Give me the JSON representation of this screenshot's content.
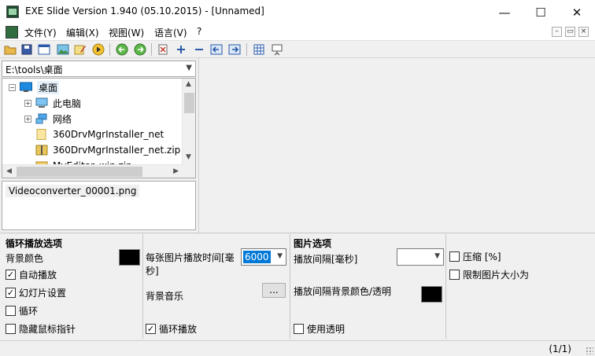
{
  "window": {
    "title": "EXE Slide Version 1.940 (05.10.2015) - [Unnamed]",
    "minimize": "—",
    "maximize": "☐",
    "close": "✕"
  },
  "menu": {
    "items": [
      "文件(Y)",
      "编辑(X)",
      "视图(W)",
      "语言(V)",
      "?"
    ],
    "mdi": [
      "–",
      "▭",
      "×"
    ]
  },
  "toolbar": {
    "icons": [
      "open-folder-icon",
      "save-icon",
      "window-icon",
      "image-icon",
      "edit-image-icon",
      "play-icon",
      "refresh-left-icon",
      "refresh-right-icon",
      "new-file-icon",
      "add-icon",
      "remove-icon",
      "move-left-icon",
      "move-right-icon",
      "grid-icon",
      "presentation-icon"
    ]
  },
  "explorer": {
    "path": "E:\\tools\\桌面",
    "tree": [
      {
        "label": "桌面",
        "expander": "−",
        "icon": "desktop-icon",
        "selected": true
      },
      {
        "label": "此电脑",
        "expander": "+",
        "icon": "computer-icon"
      },
      {
        "label": "网络",
        "expander": "+",
        "icon": "network-icon"
      },
      {
        "label": "360DrvMgrInstaller_net",
        "expander": "",
        "icon": "file-icon"
      },
      {
        "label": "360DrvMgrInstaller_net.zip",
        "expander": "",
        "icon": "zip-icon"
      },
      {
        "label": "MyEditor_win.zip",
        "expander": "",
        "icon": "folder-icon"
      }
    ],
    "files": [
      "Videoconverter_00001.png"
    ]
  },
  "options": {
    "loop_section": {
      "title": "循环播放选项",
      "bg_color_label": "背景颜色",
      "bg_color": "#000000",
      "checkboxes": [
        {
          "label": "自动播放",
          "checked": true
        },
        {
          "label": "幻灯片设置",
          "checked": true
        },
        {
          "label": "循环",
          "checked": false
        },
        {
          "label": "隐藏鼠标指针",
          "checked": false
        }
      ]
    },
    "timing_section": {
      "interval_label": "每张图片播放时间[毫秒]",
      "interval_value": "6000",
      "music_label": "背景音乐",
      "browse_button": "...",
      "loop_play": {
        "label": "循环播放",
        "checked": true
      }
    },
    "image_section": {
      "title": "图片选项",
      "gap_label": "播放间隔[毫秒]",
      "gap_value": "",
      "gap_color_label": "播放间隔背景颜色/透明",
      "gap_color": "#000000",
      "transparency": {
        "label": "使用透明",
        "checked": false
      }
    },
    "compress_section": {
      "compress": {
        "label": "压缩 [%]",
        "checked": false
      },
      "limit_size": {
        "label": "限制图片大小为",
        "checked": false
      }
    }
  },
  "status": {
    "page": "(1/1)"
  }
}
